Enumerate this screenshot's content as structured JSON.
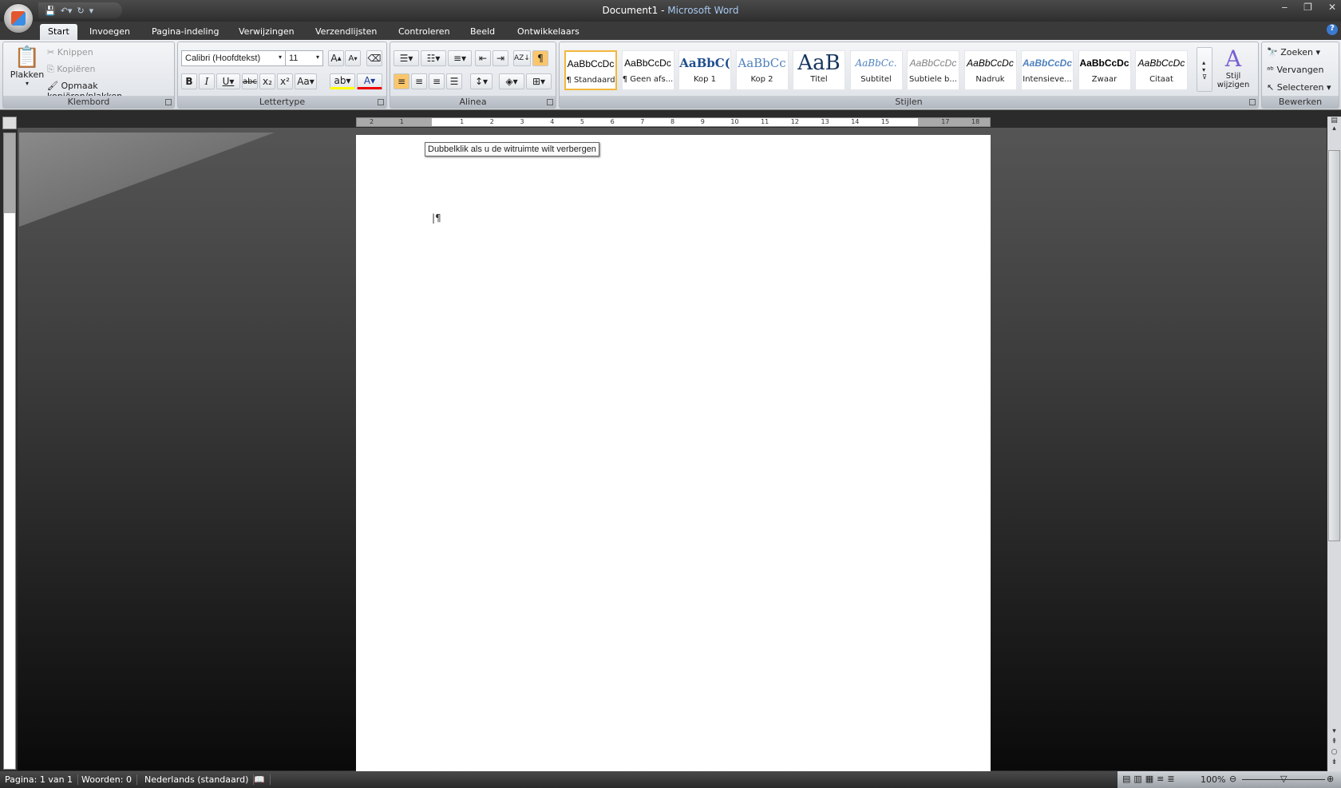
{
  "titlebar": {
    "document": "Document1",
    "separator": " - ",
    "app": "Microsoft Word"
  },
  "tabs": [
    "Start",
    "Invoegen",
    "Pagina-indeling",
    "Verwijzingen",
    "Verzendlijsten",
    "Controleren",
    "Beeld",
    "Ontwikkelaars"
  ],
  "clipboard": {
    "paste": "Plakken",
    "cut": "Knippen",
    "copy": "Kopiëren",
    "format_painter": "Opmaak kopiëren/plakken",
    "label": "Klembord"
  },
  "font": {
    "name": "Calibri (Hoofdtekst)",
    "size": "11",
    "label": "Lettertype"
  },
  "paragraph": {
    "label": "Alinea"
  },
  "styles": {
    "label": "Stijlen",
    "change": "Stijl wijzigen",
    "items": [
      {
        "preview": "AaBbCcDc",
        "name": "¶ Standaard",
        "color": "#000000"
      },
      {
        "preview": "AaBbCcDc",
        "name": "¶ Geen afs...",
        "color": "#000000"
      },
      {
        "preview": "AaBbC(",
        "name": "Kop 1",
        "color": "#1f4e8c"
      },
      {
        "preview": "AaBbCc",
        "name": "Kop 2",
        "color": "#4f81bd"
      },
      {
        "preview": "AaB",
        "name": "Titel",
        "color": "#17365d"
      },
      {
        "preview": "AaBbCc.",
        "name": "Subtitel",
        "color": "#4f81bd"
      },
      {
        "preview": "AaBbCcDc",
        "name": "Subtiele b...",
        "color": "#808080"
      },
      {
        "preview": "AaBbCcDc",
        "name": "Nadruk",
        "color": "#000000"
      },
      {
        "preview": "AaBbCcDc",
        "name": "Intensieve...",
        "color": "#4f81bd"
      },
      {
        "preview": "AaBbCcDc",
        "name": "Zwaar",
        "color": "#000000"
      },
      {
        "preview": "AaBbCcDc",
        "name": "Citaat",
        "color": "#000000"
      }
    ]
  },
  "editing": {
    "find": "Zoeken",
    "replace": "Vervangen",
    "select": "Selecteren",
    "label": "Bewerken"
  },
  "ruler": {
    "ticks": [
      "2",
      "1",
      "",
      "1",
      "2",
      "3",
      "4",
      "5",
      "6",
      "7",
      "8",
      "9",
      "10",
      "11",
      "12",
      "13",
      "14",
      "15",
      "",
      "17",
      "18"
    ]
  },
  "document": {
    "tooltip": "Dubbelklik als u de witruimte wilt verbergen"
  },
  "status": {
    "page": "Pagina: 1 van 1",
    "words": "Woorden: 0",
    "language": "Nederlands (standaard)",
    "zoom": "100%"
  }
}
